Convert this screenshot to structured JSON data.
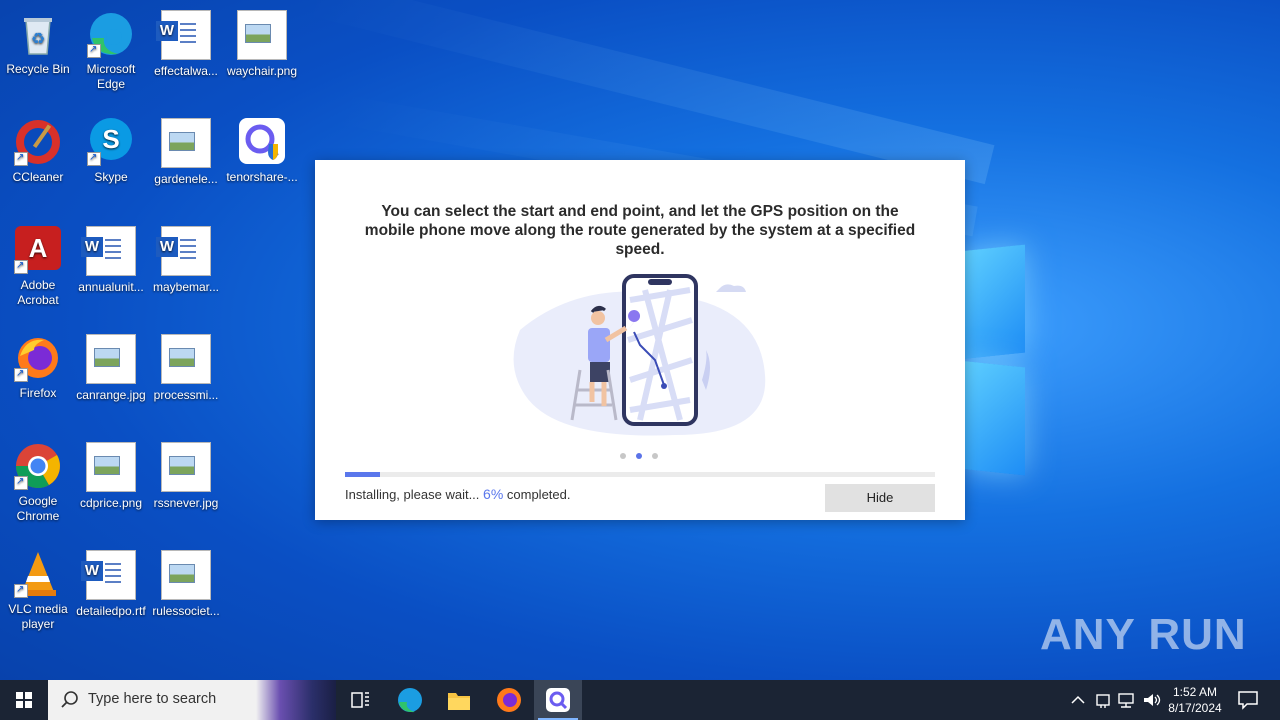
{
  "desktop": {
    "icons": [
      {
        "label": "Recycle Bin",
        "icon": "recycle-bin-icon"
      },
      {
        "label": "Microsoft Edge",
        "icon": "edge-icon"
      },
      {
        "label": "effectalwa...",
        "icon": "word-doc-icon"
      },
      {
        "label": "waychair.png",
        "icon": "image-file-icon"
      },
      {
        "label": "CCleaner",
        "icon": "ccleaner-icon"
      },
      {
        "label": "Skype",
        "icon": "skype-icon"
      },
      {
        "label": "gardenele...",
        "icon": "image-file-icon"
      },
      {
        "label": "tenorshare-...",
        "icon": "tenorshare-icon"
      },
      {
        "label": "Adobe Acrobat",
        "icon": "acrobat-icon"
      },
      {
        "label": "annualunit...",
        "icon": "word-doc-icon"
      },
      {
        "label": "maybemar...",
        "icon": "word-doc-icon"
      },
      {
        "label": "Firefox",
        "icon": "firefox-icon"
      },
      {
        "label": "canrange.jpg",
        "icon": "image-file-icon"
      },
      {
        "label": "processmi...",
        "icon": "image-file-icon"
      },
      {
        "label": "Google Chrome",
        "icon": "chrome-icon"
      },
      {
        "label": "cdprice.png",
        "icon": "image-file-icon"
      },
      {
        "label": "rssnever.jpg",
        "icon": "image-file-icon"
      },
      {
        "label": "VLC media player",
        "icon": "vlc-icon"
      },
      {
        "label": "detailedpo.rtf",
        "icon": "word-doc-icon"
      },
      {
        "label": "rulessociet...",
        "icon": "image-file-icon"
      }
    ]
  },
  "dialog": {
    "message": "You can select the start and end point, and let the GPS position on the mobile phone move along the route generated by the system at a specified speed.",
    "status_prefix": "Installing, please wait...",
    "percent_text": "6%",
    "status_suffix": "completed.",
    "progress": 0.06,
    "hide_label": "Hide",
    "carousel_active": 2,
    "carousel_total": 3
  },
  "taskbar": {
    "search_placeholder": "Type here to search",
    "time": "1:52 AM",
    "date": "8/17/2024"
  },
  "watermark": "ANY RUN"
}
